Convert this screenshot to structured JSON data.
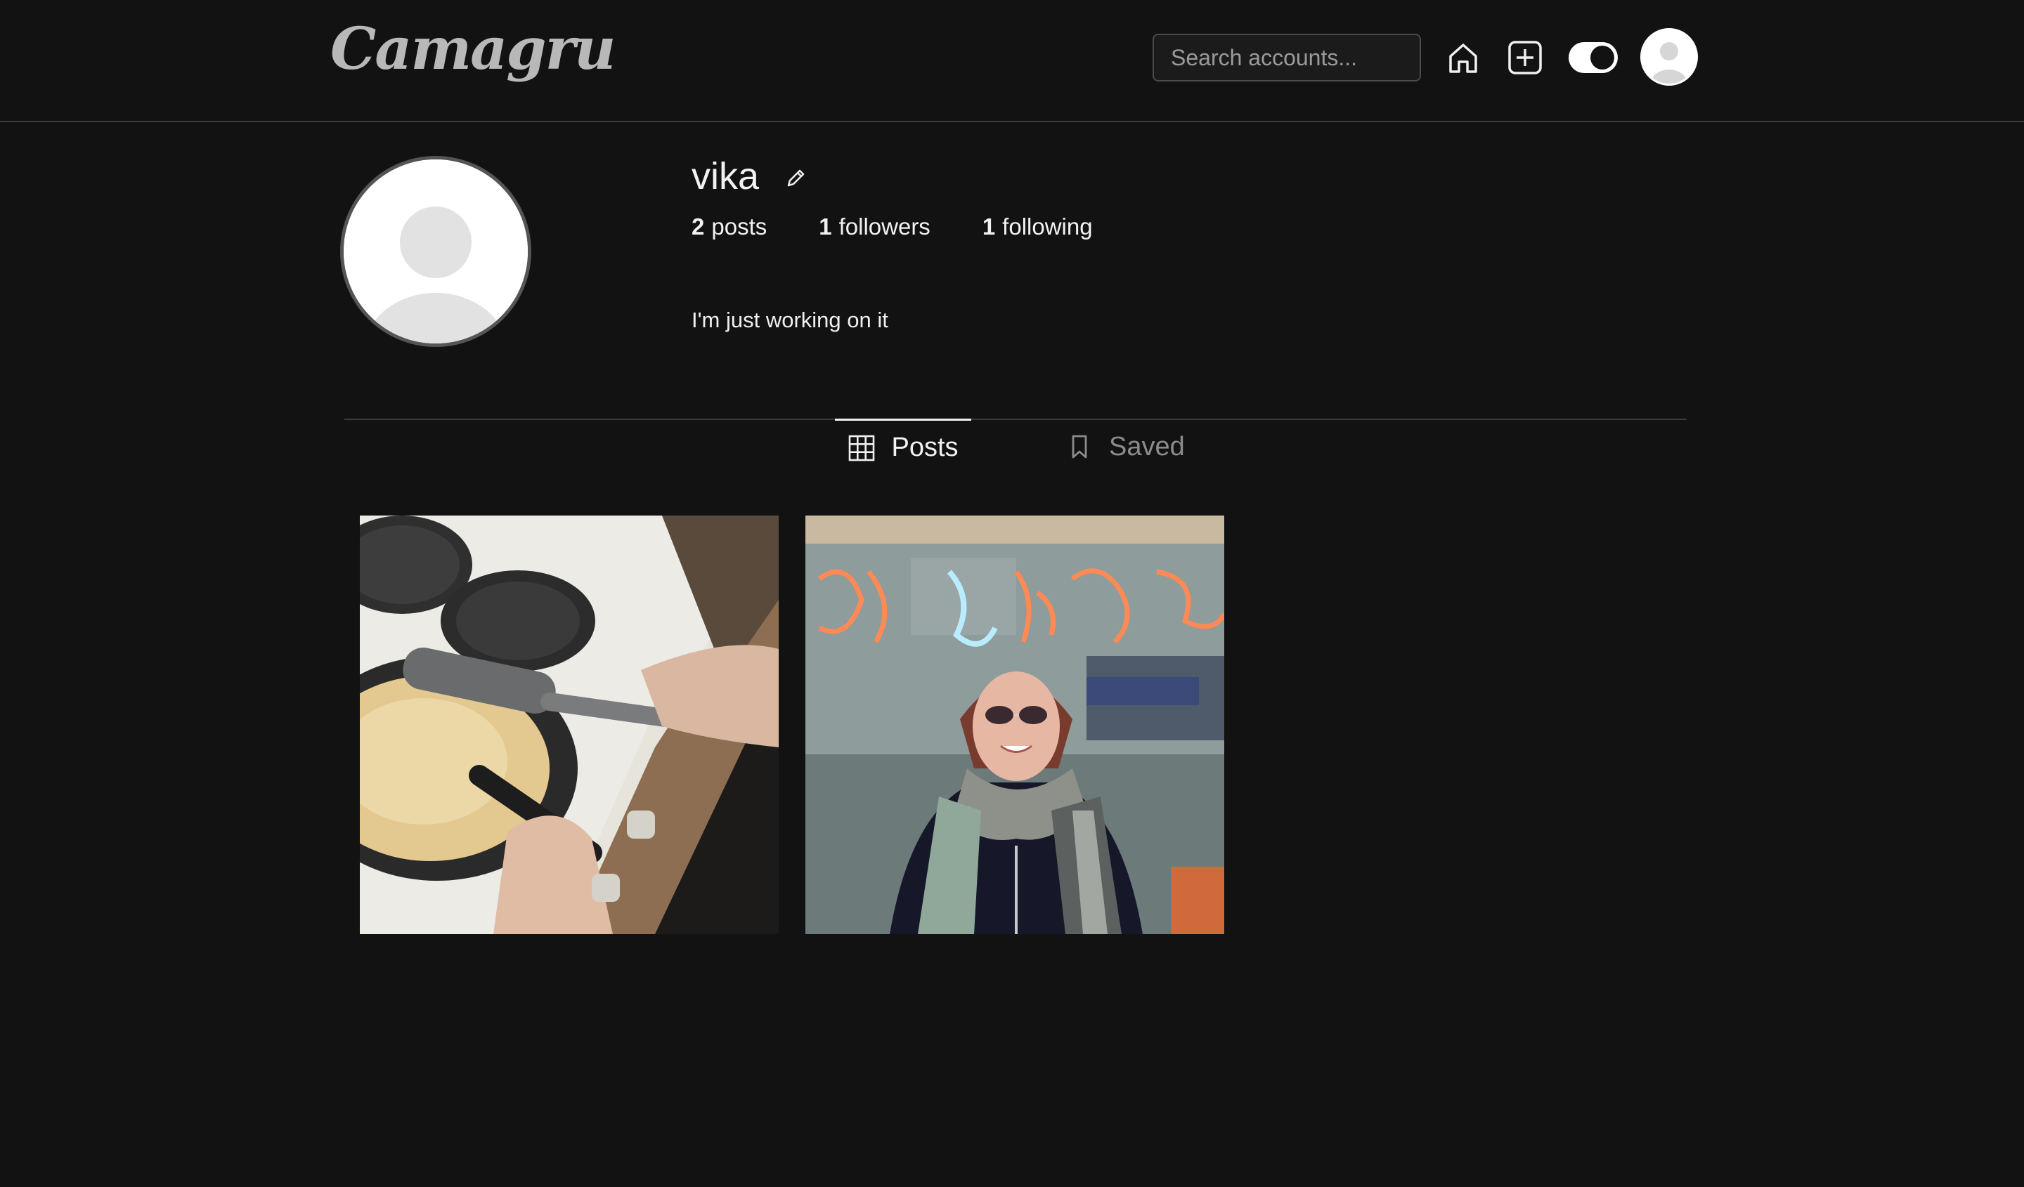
{
  "header": {
    "logo": "Camagru",
    "search": {
      "placeholder": "Search accounts...",
      "value": ""
    },
    "icons": [
      "home-icon",
      "add-post-icon",
      "theme-toggle",
      "avatar"
    ],
    "theme": "dark"
  },
  "profile": {
    "username": "vika",
    "stats": {
      "posts_count": "2",
      "posts_label": "posts",
      "followers_count": "1",
      "followers_label": "followers",
      "following_count": "1",
      "following_label": "following"
    },
    "bio": "I'm just working on it"
  },
  "tabs": [
    {
      "label": "Posts",
      "icon": "grid-icon",
      "active": true
    },
    {
      "label": "Saved",
      "icon": "bookmark-icon",
      "active": false
    }
  ],
  "posts": [
    {
      "thumbnail": "pancake-pan-photo"
    },
    {
      "thumbnail": "woman-scarf-neon-photo"
    }
  ],
  "colors": {
    "background": "#121212",
    "border": "#3a3a3a",
    "text": "#f2f2f2",
    "muted": "#8c8c8c"
  }
}
